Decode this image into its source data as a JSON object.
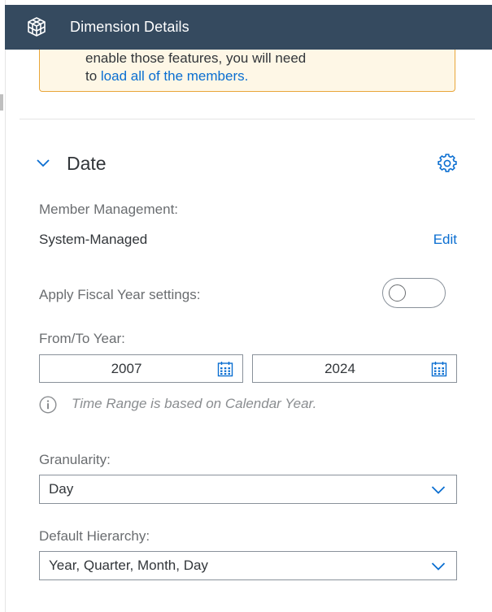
{
  "header": {
    "title": "Dimension Details",
    "icon": "cube-icon",
    "background": "#354a5f"
  },
  "warning": {
    "line1": "enable those features, you will need",
    "line2_prefix": "to ",
    "line2_link": "load all of the members."
  },
  "section": {
    "title": "Date",
    "expand_icon": "chevron-down-icon",
    "settings_icon": "gear-icon"
  },
  "member_management": {
    "label": "Member Management:",
    "value": "System-Managed",
    "edit_label": "Edit"
  },
  "fiscal_year": {
    "label": "Apply Fiscal Year settings:",
    "enabled": false
  },
  "year_range": {
    "label": "From/To Year:",
    "from": "2007",
    "to": "2024",
    "icon": "calendar-icon"
  },
  "info": {
    "icon": "info-icon",
    "text": "Time Range is based on Calendar Year."
  },
  "granularity": {
    "label": "Granularity:",
    "value": "Day"
  },
  "default_hierarchy": {
    "label": "Default Hierarchy:",
    "value": "Year, Quarter, Month, Day"
  },
  "colors": {
    "accent": "#0a6ed1",
    "warning_border": "#e9a63a",
    "warning_bg": "#fef7e6"
  }
}
